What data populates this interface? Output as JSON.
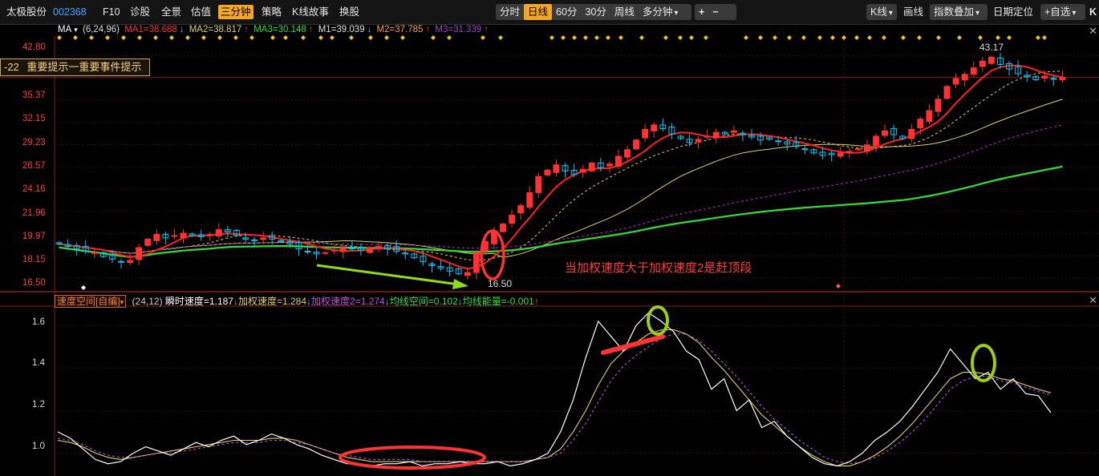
{
  "toolbar": {
    "stock_name": "太极股份",
    "stock_code": "002368",
    "left_items": [
      "F10",
      "诊股",
      "全景",
      "估值",
      "三分钟",
      "策略",
      "K线故事",
      "换股"
    ],
    "left_active": "三分钟",
    "period_items": [
      "分时",
      "日线",
      "60分",
      "30分",
      "周线",
      "多分钟"
    ],
    "period_active": "日线",
    "zoom_plus": "+",
    "zoom_minus": "−",
    "right_items": [
      "K线",
      "画线",
      "指数叠加",
      "日期定位",
      "+自选"
    ]
  },
  "ma_header": {
    "name": "MA",
    "params": "(6,24,96)",
    "ma1": "MA1=38.688",
    "ma2": "MA2=38.817",
    "ma3": "MA3=30.148",
    "m1": "M1=39.039",
    "m2": "M2=37.785",
    "m3": "M3=31.339"
  },
  "event_box": {
    "prefix": "-22",
    "text": "重要提示一重要事件提示"
  },
  "price_axis": {
    "labels": [
      "42.80",
      "35.37",
      "32.15",
      "29.23",
      "26.57",
      "24.16",
      "21.96",
      "19.97",
      "18.15",
      "16.50"
    ],
    "high_label": "43.17",
    "low_label": "16.50"
  },
  "annotation": "当加权速度大于加权速度2是赶顶段",
  "indicator_header": {
    "name": "速度空间[自编]",
    "params": "(24,12)",
    "v1": "瞬时速度=1.187",
    "v2": "加权速度=1.284",
    "v3": "加权速度2=1.274",
    "v4": "均线空间=0.102",
    "v5": "均线能量=-0.001"
  },
  "indicator_axis": {
    "labels": [
      "1.6",
      "1.4",
      "1.2",
      "1.0"
    ]
  },
  "colors": {
    "up": "#ff3333",
    "down": "#00c8ff",
    "ma1": "#ff2020",
    "ma2": "#e0d060",
    "ma3": "#30e030",
    "m3": "#a020c0",
    "annotation_red": "#ff3333",
    "arrow_green": "#8fdc1e",
    "circle_green": "#9acd1a",
    "active_tab": "#f5a623"
  },
  "chart_data": [
    {
      "type": "candlestick",
      "title": "太极股份 002368 日线",
      "ylabel": "",
      "yscale": "log",
      "ylim": [
        16.0,
        44.5
      ],
      "ticks": [
        42.8,
        35.37,
        32.15,
        29.23,
        26.57,
        24.16,
        21.96,
        19.97,
        18.15,
        16.5
      ],
      "close": [
        19.1,
        18.9,
        18.7,
        18.5,
        18.4,
        18.1,
        17.9,
        17.7,
        17.8,
        18.8,
        19.5,
        19.9,
        19.6,
        19.8,
        20.0,
        19.8,
        19.7,
        19.9,
        20.3,
        20.1,
        19.8,
        19.5,
        19.4,
        19.6,
        19.5,
        19.3,
        19.1,
        18.7,
        18.5,
        18.3,
        18.4,
        18.6,
        18.8,
        18.7,
        18.6,
        18.8,
        18.9,
        18.7,
        18.5,
        18.3,
        18.0,
        17.7,
        17.4,
        17.2,
        17.0,
        16.8,
        16.9,
        18.4,
        19.3,
        20.2,
        20.8,
        21.6,
        22.5,
        23.8,
        25.5,
        26.2,
        26.8,
        26.1,
        25.7,
        26.3,
        27.0,
        26.5,
        26.9,
        27.8,
        28.6,
        29.8,
        31.2,
        31.8,
        31.3,
        30.6,
        30.0,
        29.5,
        29.9,
        30.3,
        30.8,
        30.6,
        31.0,
        30.5,
        30.2,
        29.8,
        29.9,
        29.6,
        29.3,
        29.0,
        28.7,
        28.2,
        27.9,
        28.0,
        28.2,
        28.4,
        28.7,
        29.2,
        30.3,
        31.0,
        30.5,
        30.0,
        31.2,
        32.6,
        33.8,
        35.5,
        37.5,
        38.8,
        39.5,
        40.6,
        41.8,
        42.5,
        41.2,
        40.4,
        39.6,
        39.1,
        38.6,
        39.2,
        38.7,
        39.0
      ],
      "high_label": 43.17,
      "low_label": 16.5,
      "series": [
        {
          "name": "MA1",
          "value": 38.688
        },
        {
          "name": "MA2",
          "value": 38.817
        },
        {
          "name": "MA3",
          "value": 30.148
        },
        {
          "name": "M1",
          "value": 39.039
        },
        {
          "name": "M2",
          "value": 37.785
        },
        {
          "name": "M3",
          "value": 31.339
        }
      ]
    },
    {
      "type": "line",
      "title": "速度空间[自编]",
      "ylim": [
        0.9,
        1.68
      ],
      "ticks": [
        1.6,
        1.4,
        1.2,
        1.0
      ],
      "series": [
        {
          "name": "瞬时速度",
          "values": [
            1.1,
            1.07,
            1.02,
            0.97,
            0.95,
            0.96,
            1.0,
            1.03,
            1.01,
            0.99,
            1.02,
            1.05,
            1.03,
            1.06,
            1.08,
            1.04,
            1.06,
            1.09,
            1.07,
            1.04,
            1.02,
            0.99,
            0.97,
            0.95,
            0.95,
            0.94,
            0.95,
            0.95,
            0.96,
            0.94,
            0.95,
            0.95,
            0.96,
            0.95,
            0.95,
            0.96,
            0.94,
            0.95,
            0.97,
            1.0,
            1.1,
            1.25,
            1.45,
            1.62,
            1.55,
            1.48,
            1.6,
            1.66,
            1.62,
            1.57,
            1.48,
            1.44,
            1.3,
            1.35,
            1.2,
            1.25,
            1.12,
            1.15,
            1.08,
            1.03,
            0.98,
            0.95,
            0.94,
            0.96,
            1.0,
            1.06,
            1.1,
            1.15,
            1.22,
            1.3,
            1.38,
            1.49,
            1.42,
            1.35,
            1.38,
            1.3,
            1.35,
            1.28,
            1.27,
            1.19
          ]
        },
        {
          "name": "加权速度",
          "values": [
            1.06,
            1.05,
            1.03,
            1.0,
            0.98,
            0.97,
            0.98,
            0.99,
            1.0,
            1.01,
            1.02,
            1.03,
            1.04,
            1.05,
            1.06,
            1.06,
            1.06,
            1.07,
            1.07,
            1.06,
            1.04,
            1.02,
            1.0,
            0.98,
            0.97,
            0.96,
            0.96,
            0.96,
            0.96,
            0.96,
            0.96,
            0.96,
            0.96,
            0.96,
            0.96,
            0.96,
            0.96,
            0.96,
            0.97,
            0.98,
            1.02,
            1.1,
            1.2,
            1.32,
            1.42,
            1.48,
            1.52,
            1.56,
            1.58,
            1.58,
            1.56,
            1.52,
            1.45,
            1.39,
            1.32,
            1.25,
            1.18,
            1.13,
            1.08,
            1.03,
            0.99,
            0.96,
            0.94,
            0.94,
            0.96,
            0.99,
            1.03,
            1.08,
            1.14,
            1.21,
            1.28,
            1.35,
            1.38,
            1.38,
            1.37,
            1.35,
            1.34,
            1.32,
            1.3,
            1.284
          ]
        },
        {
          "name": "加权速度2",
          "values": [
            1.07,
            1.06,
            1.04,
            1.01,
            0.99,
            0.98,
            0.98,
            0.99,
            1.0,
            1.0,
            1.01,
            1.02,
            1.03,
            1.04,
            1.05,
            1.05,
            1.05,
            1.06,
            1.06,
            1.05,
            1.04,
            1.02,
            1.0,
            0.99,
            0.98,
            0.97,
            0.97,
            0.97,
            0.97,
            0.96,
            0.96,
            0.96,
            0.96,
            0.96,
            0.96,
            0.96,
            0.96,
            0.96,
            0.97,
            0.98,
            1.0,
            1.06,
            1.14,
            1.24,
            1.34,
            1.41,
            1.46,
            1.5,
            1.54,
            1.56,
            1.56,
            1.53,
            1.48,
            1.42,
            1.36,
            1.29,
            1.22,
            1.16,
            1.11,
            1.06,
            1.02,
            0.98,
            0.96,
            0.95,
            0.96,
            0.98,
            1.01,
            1.05,
            1.1,
            1.16,
            1.23,
            1.3,
            1.34,
            1.36,
            1.36,
            1.34,
            1.33,
            1.31,
            1.29,
            1.274
          ]
        }
      ]
    }
  ]
}
